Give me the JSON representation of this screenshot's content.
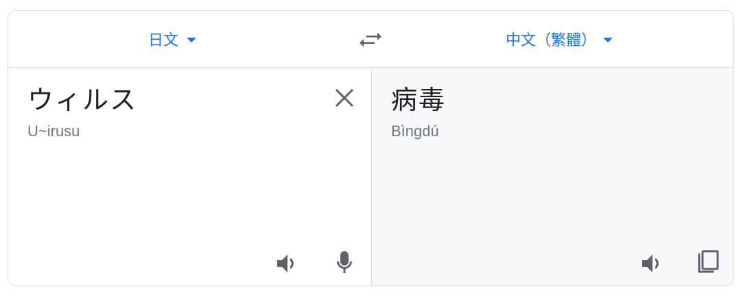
{
  "languages": {
    "source": "日文",
    "target": "中文（繁體）"
  },
  "source_panel": {
    "text": "ウィルス",
    "romanization": "U~irusu"
  },
  "target_panel": {
    "text": "病毒",
    "romanization": "Bìngdú"
  },
  "icons": {
    "caret": "dropdown-caret",
    "swap": "swap-arrows-icon",
    "clear": "close-icon",
    "speaker": "speaker-icon",
    "mic": "microphone-icon",
    "copy": "copy-icon"
  },
  "colors": {
    "accent": "#1a73e8",
    "text": "#202124",
    "secondary": "#70757a",
    "icon": "#5f6368",
    "border": "#dadce0",
    "target_bg": "#f8f9fa"
  }
}
